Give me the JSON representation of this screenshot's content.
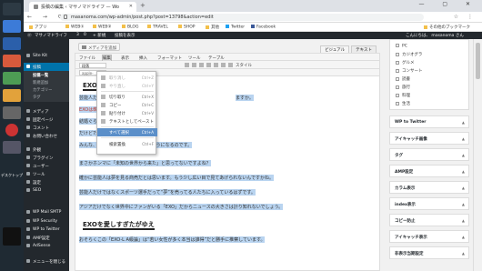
{
  "browser": {
    "tab_title": "投稿の編集 ‹ マサノマドライフ — Wo",
    "url": "masanoma.com/wp-admin/post.php?post=13798&action=edit",
    "newtab": "+",
    "winctl": "— ▢ ✕"
  },
  "bookmarks": [
    "アプリ",
    "WEB①",
    "WEB②",
    "BLOG",
    "TRAVEL",
    "SHOP",
    "其他",
    "Twitter",
    "Facebook",
    "その他のブックマーク"
  ],
  "adminbar": {
    "site": "マサノマドライフ",
    "updates": "3",
    "comments": "0",
    "new": "+ 新規",
    "view": "投稿を表示",
    "user": "こんにちは、 masanoma さん"
  },
  "taskbar": {
    "desktop": "デスクトップ"
  },
  "sidebar": {
    "items": [
      {
        "label": "Site Kit"
      },
      {
        "label": "投稿",
        "active": true
      },
      {
        "label": "メディア"
      },
      {
        "label": "固定ページ"
      },
      {
        "label": "コメント"
      },
      {
        "label": "お問い合わせ"
      },
      {
        "label": "外観"
      },
      {
        "label": "プラグイン"
      },
      {
        "label": "ユーザー"
      },
      {
        "label": "ツール"
      },
      {
        "label": "設定"
      },
      {
        "label": "SEO"
      },
      {
        "label": "WP Security"
      },
      {
        "label": "WP to Twitter"
      },
      {
        "label": "AMP設定"
      },
      {
        "label": "AdSense"
      },
      {
        "label": "WP Mail SMTP"
      },
      {
        "label": "メニューを閉じる"
      }
    ],
    "subitems": [
      "投稿一覧",
      "新規追加",
      "カテゴリー",
      "タグ"
    ]
  },
  "editor": {
    "media_button": "メディアを追加",
    "tab_visual": "ビジュアル",
    "tab_text": "テキスト",
    "menus": [
      "ファイル",
      "編集",
      "表示",
      "挿入",
      "フォーマット",
      "ツール",
      "テーブル"
    ],
    "paragraph_select": "段落",
    "style_label": "スタイル",
    "font_select": "apple-system"
  },
  "dropdown": {
    "items": [
      {
        "label": "取り消し",
        "key": "Ctrl+Z",
        "disabled": true
      },
      {
        "label": "やり直し",
        "key": "Ctrl+Y",
        "disabled": true
      },
      {
        "sep": true
      },
      {
        "label": "切り取り",
        "key": "Ctrl+X"
      },
      {
        "label": "コピー",
        "key": "Ctrl+C"
      },
      {
        "label": "貼り付け",
        "key": "Ctrl+V"
      },
      {
        "label": "テキストとしてペースト",
        "key": ""
      },
      {
        "sep": true
      },
      {
        "label": "すべて選択",
        "key": "Ctrl+A",
        "hi": true
      },
      {
        "sep": true
      },
      {
        "label": "検索置換",
        "key": "Ctrl+F"
      }
    ]
  },
  "content": {
    "heading1": "EXOの",
    "p1": "芸能人だ",
    "p1b": "ますか。",
    "p2": "EXOは韓国",
    "p3": "結婚ぐらい",
    "p4": "だけど7年",
    "p5": "みんな、やがて結婚して家庭をもつようになるのです。",
    "p6": "まさかホンマに「未知の世界から来た」と思ってないですよね？",
    "p7": "確かに芸能人は夢を見る商売だとは思います。もう少し広い目で見てあげられないんですかね。",
    "p8": "芸能人だけではなくスポーツ選手だって“夢”を売ってる人たちに入っているはずです。",
    "p9": "アジアだけでなく世界中にファンがいる「EXO」だからニュースの大きさは計り知れないでしょう。",
    "heading2": "EXOを愛しすぎたがゆえ",
    "p10": "おそらくこの「EXO-L A級論」は“若い女性が多く本当は誰得”だと勝手に推察しています。"
  },
  "categories": [
    "PC",
    "カジオグラ",
    "グルメ",
    "コンサート",
    "読書",
    "旅行",
    "料理",
    "生活"
  ],
  "metaboxes": [
    "WP to Twitter",
    "アイキャッチ画像",
    "タグ",
    "AMP設定",
    "カラム表示",
    "index表示",
    "コピー防止",
    "アイキャッチ表示",
    "非表示当期設定"
  ]
}
